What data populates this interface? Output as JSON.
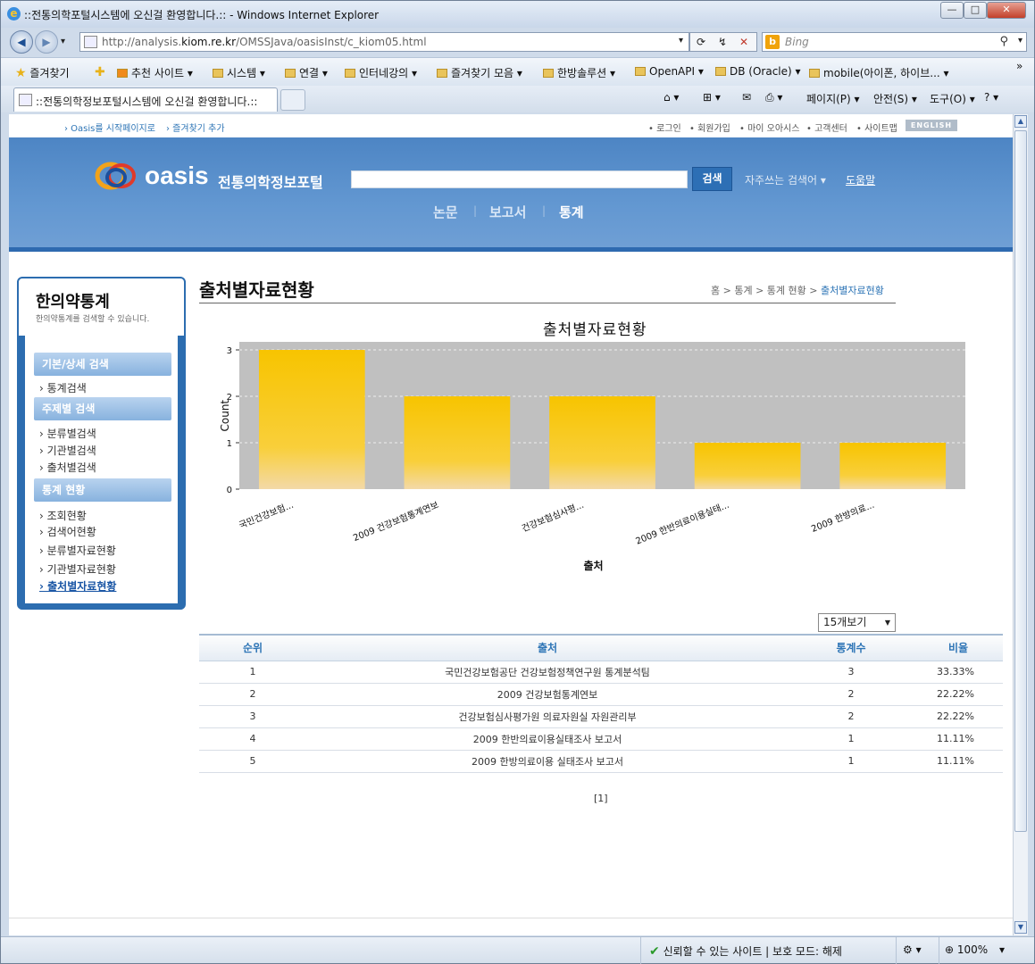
{
  "window": {
    "title": "::전통의학포털시스템에 오신걸 환영합니다.:: - Windows Internet Explorer",
    "min": "—",
    "max": "□",
    "close": "✕"
  },
  "browser": {
    "url_prefix": "http://analysis.",
    "url_domain": "kiom.re.kr",
    "url_path": "/OMSSJava/oasisInst/c_kiom05.html",
    "search_placeholder": "Bing",
    "search_logo": "b",
    "back": "◀",
    "forward": "▶",
    "dropdown": "▾",
    "tools": [
      "⟳",
      "↯",
      "✕"
    ],
    "mag": "⚲",
    "favorites_label": "즐겨찾기",
    "favorites": [
      "추천 사이트 ▾",
      "시스템 ▾",
      "연결 ▾",
      "인터네강의 ▾",
      "즐겨찾기 모음 ▾",
      "한방솔루션 ▾",
      "OpenAPI ▾",
      "DB (Oracle) ▾",
      "mobile(아이폰, 하이브... ▾"
    ],
    "chevron": "»",
    "tab_title": "::전통의학정보포털시스템에 오신걸 환영합니다.::",
    "commands": [
      "⌂ ▾",
      "⊞ ▾",
      "✉",
      "⎙ ▾",
      "페이지(P) ▾",
      "안전(S) ▾",
      "도구(O) ▾",
      "? ▾"
    ]
  },
  "site": {
    "util_left": [
      "› Oasis를 시작페이지로",
      "› 즐겨찾기 추가"
    ],
    "util_right": [
      "• 로그인",
      "• 회원가입",
      "• 마이 오아시스",
      "• 고객센터",
      "• 사이트맵"
    ],
    "english": "ENGLISH",
    "logo": "oasis",
    "logo_sub": "전통의학정보포털",
    "search_button": "검색",
    "frequent": "자주쓰는 검색어 ▾",
    "help": "도움말",
    "gnb": [
      "논문",
      "보고서",
      "통계"
    ],
    "gnb_sep": "|"
  },
  "left": {
    "title": "한의약통계",
    "subtitle": "한의약통계를 검색할 수 있습니다.",
    "sections": [
      {
        "label": "기본/상세 검색",
        "items": [
          "› 통계검색"
        ]
      },
      {
        "label": "주제별 검색",
        "items": [
          "› 분류별검색",
          "› 기관별검색",
          "› 출처별검색"
        ]
      },
      {
        "label": "통계 현황",
        "items": [
          "› 조회현황",
          "› 검색어현황",
          "› 분류별자료현황",
          "› 기관별자료현황",
          "› 출처별자료현황"
        ]
      }
    ]
  },
  "content": {
    "title": "출처별자료현황",
    "breadcrumb": "홈 > 통계 > 통계 현황 > ",
    "breadcrumb_current": "출처별자료현황",
    "page_size": "15개보기",
    "page_size_arrow": "▼",
    "columns": [
      "순위",
      "출처",
      "통계수",
      "비율"
    ],
    "rows": [
      [
        "1",
        "국민건강보험공단 건강보험정책연구원 통계분석팀",
        "3",
        "33.33%"
      ],
      [
        "2",
        "2009 건강보험통계연보",
        "2",
        "22.22%"
      ],
      [
        "3",
        "건강보험심사평가원 의료자원실 자원관리부",
        "2",
        "22.22%"
      ],
      [
        "4",
        "2009 한반의료이용실태조사 보고서",
        "1",
        "11.11%"
      ],
      [
        "5",
        "2009 한방의료이용 실태조사 보고서",
        "1",
        "11.11%"
      ]
    ],
    "pager": "[1]"
  },
  "chart_data": {
    "type": "bar",
    "title": "출처별자료현황",
    "xlabel": "출처",
    "ylabel": "Count",
    "categories": [
      "국민건강보험...",
      "2009 건강보험통계연보",
      "건강보험심사평...",
      "2009 한반의료이용실태...",
      "2009 한방의료..."
    ],
    "values": [
      3,
      2,
      2,
      1,
      1
    ],
    "ylim": [
      0,
      3
    ],
    "yticks": [
      0,
      1,
      2,
      3
    ],
    "grid": true,
    "bar_color": "#f5c400",
    "plot_bg": "#c0c0c0"
  },
  "status": {
    "trusted": "신뢰할 수 있는 사이트 | 보호 모드: 해제",
    "check": "✔",
    "zoom": "100%",
    "zoom_icon": "⊕",
    "arrow": "▾"
  }
}
